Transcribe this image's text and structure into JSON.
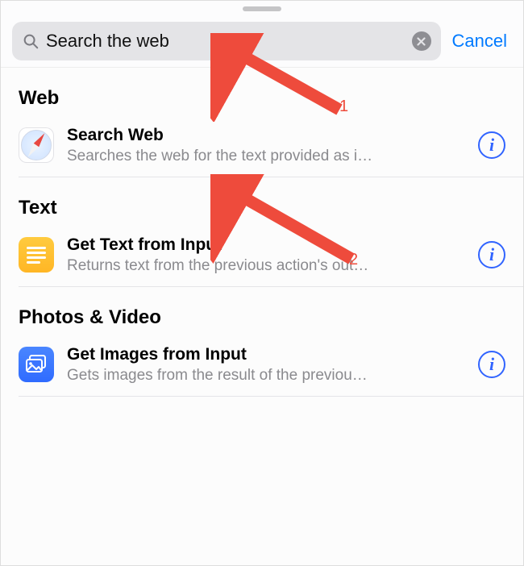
{
  "search": {
    "value": "Search the web",
    "clear_icon": "xmark-circle-fill",
    "cancel_label": "Cancel"
  },
  "sections": [
    {
      "header": "Web",
      "items": [
        {
          "icon": "safari-icon",
          "title": "Search Web",
          "subtitle": "Searches the web for the text provided as i…"
        }
      ]
    },
    {
      "header": "Text",
      "items": [
        {
          "icon": "text-document-icon",
          "title": "Get Text from Input",
          "subtitle": "Returns text from the previous action's out…"
        }
      ]
    },
    {
      "header": "Photos & Video",
      "items": [
        {
          "icon": "photo-stack-icon",
          "title": "Get Images from Input",
          "subtitle": "Gets images from the result of the previou…"
        }
      ]
    }
  ],
  "annotations": {
    "label1": "1",
    "label2": "2"
  },
  "colors": {
    "accent_blue": "#007aff",
    "info_blue": "#3164ff",
    "annotation_red": "#ee4b3c"
  }
}
